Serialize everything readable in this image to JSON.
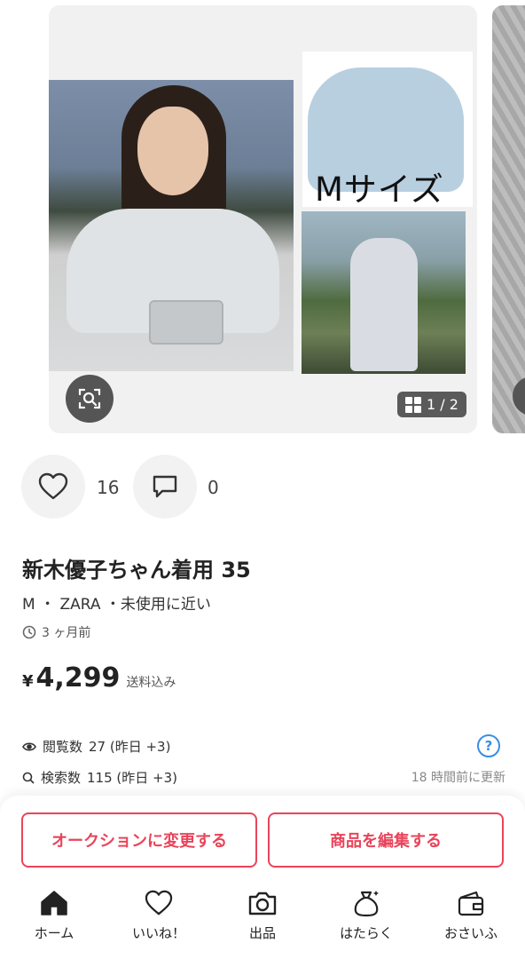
{
  "carousel": {
    "overlay_text": "Mサイズ",
    "counter": "1 / 2",
    "scan_icon": "image-search-icon",
    "grid_icon": "grid-icon"
  },
  "actions": {
    "like_icon": "heart-icon",
    "like_count": "16",
    "comment_icon": "comment-icon",
    "comment_count": "0"
  },
  "item": {
    "title": "新木優子ちゃん着用 35",
    "meta": "M ・ ZARA ・未使用に近い",
    "posted": "3 ヶ月前",
    "price_symbol": "¥",
    "price": "4,299",
    "shipping": "送料込み"
  },
  "stats": {
    "views_label": "閲覧数",
    "views_value": "27 (昨日 +3)",
    "searches_label": "検索数",
    "searches_value": "115 (昨日 +3)",
    "updated": "18 時間前に更新"
  },
  "buttons": {
    "auction": "オークションに変更する",
    "edit": "商品を編集する"
  },
  "tabs": [
    {
      "label": "ホーム",
      "icon": "home-icon"
    },
    {
      "label": "いいね！",
      "icon": "heart-icon"
    },
    {
      "label": "出品",
      "icon": "camera-icon"
    },
    {
      "label": "はたらく",
      "icon": "money-bag-icon"
    },
    {
      "label": "おさいふ",
      "icon": "wallet-icon"
    }
  ],
  "colors": {
    "accent": "#e9445a",
    "help": "#3a8de6"
  }
}
